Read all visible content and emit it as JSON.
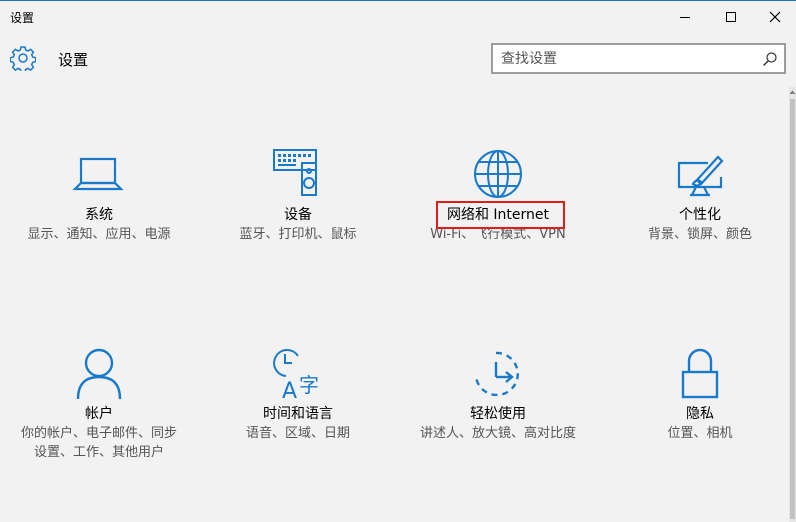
{
  "window": {
    "title": "设置"
  },
  "header": {
    "title": "设置"
  },
  "search": {
    "placeholder": "查找设置"
  },
  "colors": {
    "accent": "#1979ca",
    "highlight": "#e31b1b"
  },
  "tiles": [
    {
      "name": "系统",
      "desc": "显示、通知、应用、电源",
      "icon": "laptop-icon"
    },
    {
      "name": "设备",
      "desc": "蓝牙、打印机、鼠标",
      "icon": "devices-icon"
    },
    {
      "name": "网络和 Internet",
      "desc": "Wi-Fi、飞行模式、VPN",
      "icon": "globe-icon"
    },
    {
      "name": "个性化",
      "desc": "背景、锁屏、颜色",
      "icon": "personalization-icon"
    },
    {
      "name": "帐户",
      "desc": "你的帐户、电子邮件、同步设置、工作、其他用户",
      "icon": "person-icon"
    },
    {
      "name": "时间和语言",
      "desc": "语音、区域、日期",
      "icon": "time-language-icon"
    },
    {
      "name": "轻松使用",
      "desc": "讲述人、放大镜、高对比度",
      "icon": "ease-of-access-icon"
    },
    {
      "name": "隐私",
      "desc": "位置、相机",
      "icon": "lock-icon"
    }
  ]
}
